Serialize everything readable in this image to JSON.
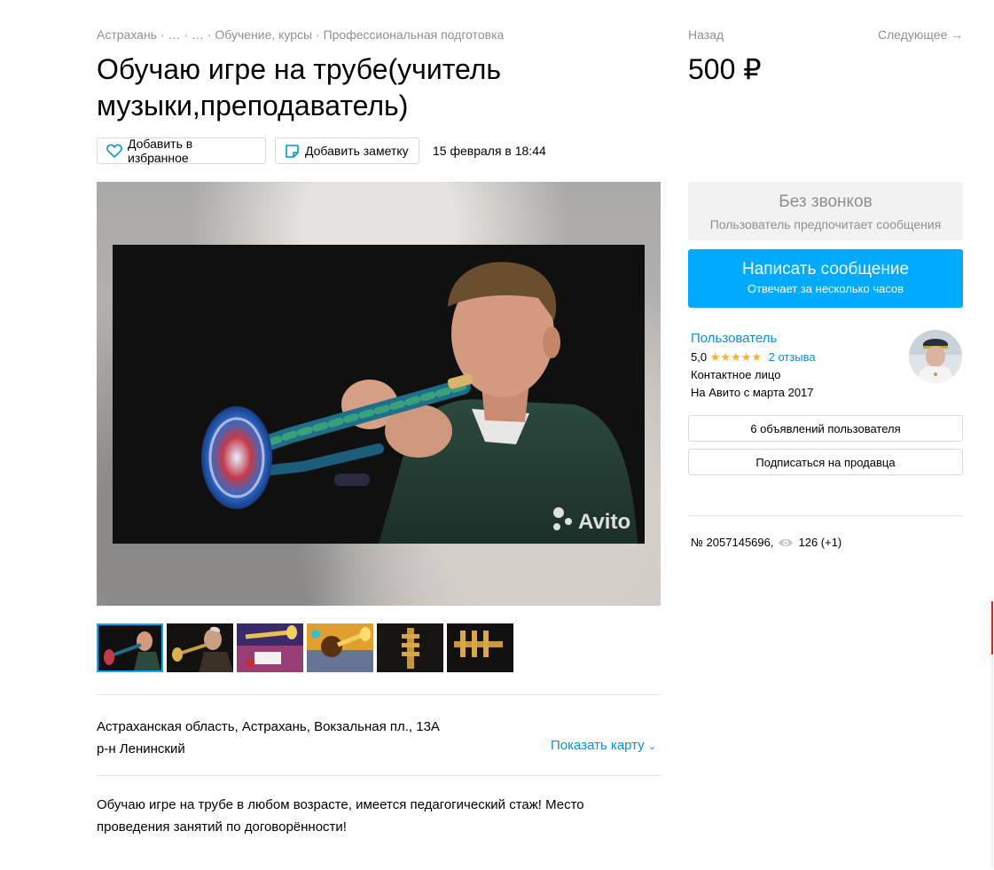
{
  "breadcrumb": {
    "items": [
      "Астрахань",
      "…",
      "…",
      "Обучение, курсы",
      "Профессиональная подготовка"
    ],
    "separator": "·"
  },
  "nav": {
    "back": "Назад",
    "next": "Следующее →"
  },
  "listing": {
    "title": "Обучаю игре на трубе(учитель музыки,преподаватель)",
    "price": "500 ₽",
    "date": "15 февраля в 18:44",
    "favorite_label": "Добавить в избранное",
    "note_label": "Добавить заметку"
  },
  "photo": {
    "watermark": "Avito"
  },
  "contact": {
    "no_calls_title": "Без звонков",
    "no_calls_subtitle": "Пользователь предпочитает сообщения",
    "message_button": "Написать сообщение",
    "message_subtitle": "Отвечает за несколько часов"
  },
  "seller": {
    "name": "Пользователь",
    "rating": "5,0",
    "stars": "★★★★★",
    "reviews": "2 отзыва",
    "role": "Контактное лицо",
    "since": "На Авито с марта 2017",
    "ads_button": "6 объявлений пользователя",
    "subscribe_button": "Подписаться на продавца"
  },
  "meta": {
    "number": "№ 2057145696,",
    "views": "126 (+1)"
  },
  "location": {
    "address": "Астраханская область, Астрахань, Вокзальная пл., 13А",
    "district": "р-н Ленинский",
    "show_map": "Показать карту"
  },
  "description": "Обучаю игре на трубе в любом возрасте, имеется педагогический стаж! Место проведения занятий по договорённости!",
  "colors": {
    "accent": "#00aaff",
    "link": "#0a90d8",
    "star": "#ffb021",
    "muted": "#8f8f8f"
  },
  "icons": [
    "heart-icon",
    "note-icon",
    "eye-icon",
    "chevron-down-icon"
  ]
}
